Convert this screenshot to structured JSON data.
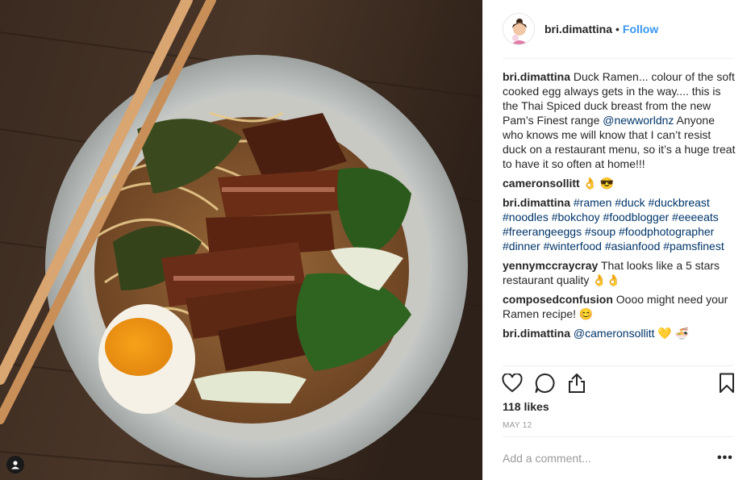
{
  "post": {
    "username": "bri.dimattina",
    "separator": "•",
    "follow_label": "Follow",
    "caption_parts": [
      "Duck Ramen... colour of the soft cooked egg always gets in the way.... this is the Thai Spiced duck breast from the new Pam’s Finest range ",
      "@newworldnz",
      " Anyone who knows me will know that I can’t resist duck on a restaurant menu, so it’s a huge treat to have it so often at home!!!"
    ],
    "likes": "118 likes",
    "date": "MAY 12",
    "add_comment_placeholder": "Add a comment...",
    "more_label": "•••"
  },
  "comments": [
    {
      "user": "cameronsollitt",
      "text": "👌 😎"
    },
    {
      "user": "bri.dimattina",
      "hashtags": "#ramen #duck #duckbreast #noodles #bokchoy #foodblogger #eeeeats #freerangeeggs #soup #foodphotographer #dinner #winterfood #asianfood #pamsfinest"
    },
    {
      "user": "yennymccraycray",
      "text": "That looks like a 5 stars restaurant quality 👌👌"
    },
    {
      "user": "composedconfusion",
      "text": "Oooo might need your Ramen recipe! 😊"
    },
    {
      "user": "bri.dimattina",
      "mention": "@cameronsollitt",
      "text": "💛 🍜"
    }
  ],
  "icons": {
    "like": "heart-icon",
    "comment": "comment-icon",
    "share": "share-icon",
    "save": "bookmark-icon",
    "tag": "user-tag-icon"
  },
  "colors": {
    "link": "#003569",
    "follow": "#3897f0",
    "text": "#262626",
    "muted": "#999999"
  }
}
